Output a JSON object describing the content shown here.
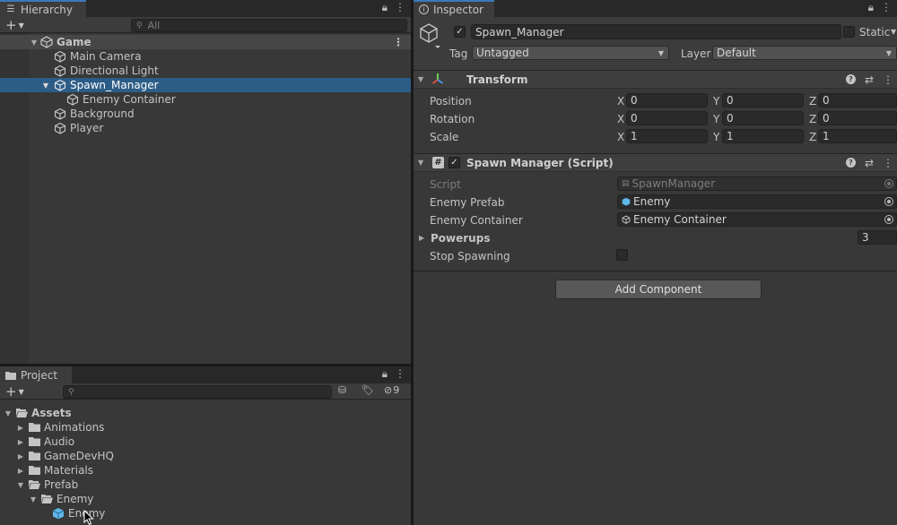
{
  "hierarchy": {
    "tab_label": "Hierarchy",
    "search_placeholder": "All",
    "add_label": "+",
    "scene": "Game",
    "items": [
      {
        "label": "Main Camera"
      },
      {
        "label": "Directional Light"
      },
      {
        "label": "Spawn_Manager",
        "selected": true
      },
      {
        "label": "Enemy Container"
      },
      {
        "label": "Background"
      },
      {
        "label": "Player"
      }
    ]
  },
  "project": {
    "tab_label": "Project",
    "add_label": "+",
    "search_placeholder": "",
    "hidden_count": "9",
    "root": "Assets",
    "folders": [
      "Animations",
      "Audio",
      "GameDevHQ",
      "Materials",
      "Prefab"
    ],
    "prefab_child": "Enemy",
    "prefab_asset": "Enemy"
  },
  "inspector": {
    "tab_label": "Inspector",
    "object_name": "Spawn_Manager",
    "static_label": "Static",
    "tag_label": "Tag",
    "tag_value": "Untagged",
    "layer_label": "Layer",
    "layer_value": "Default",
    "transform": {
      "title": "Transform",
      "rows": [
        {
          "label": "Position",
          "x": "0",
          "y": "0",
          "z": "0"
        },
        {
          "label": "Rotation",
          "x": "0",
          "y": "0",
          "z": "0"
        },
        {
          "label": "Scale",
          "x": "1",
          "y": "1",
          "z": "1"
        }
      ],
      "axes": [
        "X",
        "Y",
        "Z"
      ]
    },
    "script": {
      "title": "Spawn Manager (Script)",
      "script_label": "Script",
      "script_value": "SpawnManager",
      "enemy_prefab_label": "Enemy Prefab",
      "enemy_prefab_value": "Enemy",
      "enemy_container_label": "Enemy Container",
      "enemy_container_value": "Enemy Container",
      "powerups_label": "Powerups",
      "powerups_value": "3",
      "stop_spawning_label": "Stop Spawning"
    },
    "add_component_label": "Add Component"
  },
  "colors": {
    "selection": "#2c5d87",
    "tab_accent": "#3a79bb",
    "panel_bg": "#383838"
  }
}
